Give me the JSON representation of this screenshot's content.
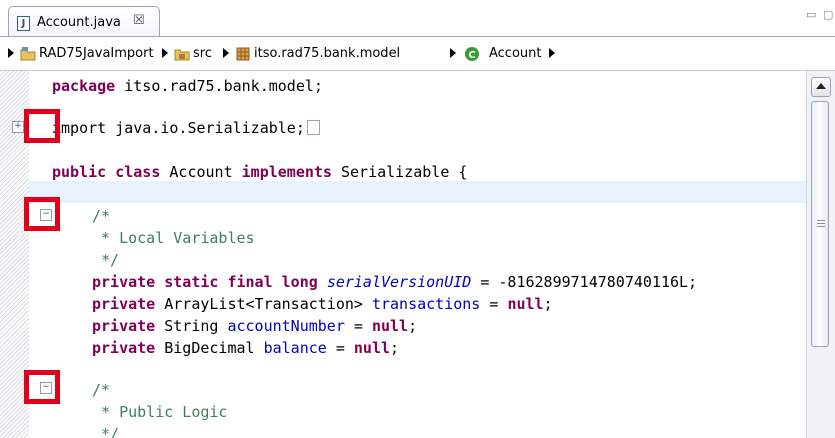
{
  "tab": {
    "title": "Account.java",
    "close_glyph": "☒",
    "file_icon_glyph": "J"
  },
  "view_controls": {
    "minimize_glyph": "▭",
    "maximize_glyph": "▢"
  },
  "breadcrumb": {
    "items": [
      {
        "label": "RAD75JavaImport",
        "icon": "project-icon"
      },
      {
        "label": "src",
        "icon": "source-folder-icon"
      },
      {
        "label": "itso.rad75.bank.model",
        "icon": "package-icon"
      },
      {
        "label": "Account",
        "icon": "class-icon"
      }
    ]
  },
  "code": {
    "package_kw": "package",
    "package_name": " itso.rad75.bank.model;",
    "import_first_char": "i",
    "import_rest": "mport java.io.Serializable;",
    "class_public": "public",
    "class_kw": "class",
    "class_name": " Account ",
    "class_implements": "implements",
    "class_rest": " Serializable {",
    "c1_open": "/*",
    "c1_text": " * Local Variables",
    "c1_close": " */",
    "f1_private": "private",
    "f1_static": "static",
    "f1_final": "final",
    "f1_long": "long",
    "f1_name": "serialVersionUID",
    "f1_rest": " = -8162899714780740116L;",
    "f2_private": "private",
    "f2_type": " ArrayList<Transaction> ",
    "f2_name": "transactions",
    "f2_eq": " = ",
    "f2_null": "null",
    "f2_semi": ";",
    "f3_private": "private",
    "f3_type": " String ",
    "f3_name": "accountNumber",
    "f3_eq": " = ",
    "f3_null": "null",
    "f3_semi": ";",
    "f4_private": "private",
    "f4_type": " BigDecimal ",
    "f4_name": "balance",
    "f4_eq": " = ",
    "f4_null": "null",
    "f4_semi": ";",
    "c2_open": "/*",
    "c2_text": " * Public Logic",
    "c2_close": " */"
  },
  "fold": {
    "expand_glyph": "+",
    "collapse_glyph": "−"
  },
  "colors": {
    "keyword": "#7f0055",
    "comment": "#3f7f5f",
    "field": "#0000c0",
    "highlight": "#e1001a"
  }
}
